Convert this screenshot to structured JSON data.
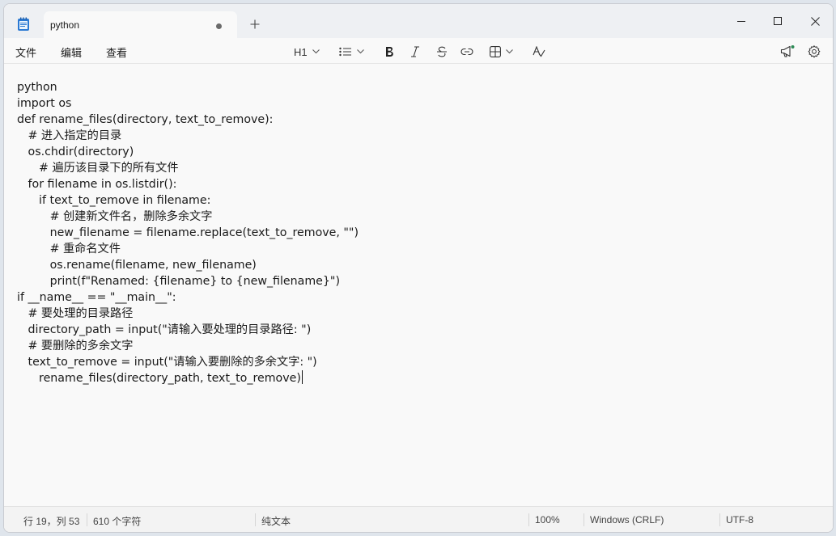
{
  "tab": {
    "title": "python"
  },
  "menu": {
    "file": "文件",
    "edit": "编辑",
    "view": "查看"
  },
  "toolbar": {
    "heading_label": "H1"
  },
  "editor": {
    "lines": [
      "python",
      "import os",
      "def rename_files(directory, text_to_remove):",
      "   # 进入指定的目录",
      "   os.chdir(directory)",
      "      # 遍历该目录下的所有文件",
      "   for filename in os.listdir():",
      "      if text_to_remove in filename:",
      "         # 创建新文件名，删除多余文字",
      "         new_filename = filename.replace(text_to_remove, \"\")",
      "         # 重命名文件",
      "         os.rename(filename, new_filename)",
      "         print(f\"Renamed: {filename} to {new_filename}\")",
      "if __name__ == \"__main__\":",
      "   # 要处理的目录路径",
      "   directory_path = input(\"请输入要处理的目录路径: \")",
      "   # 要删除的多余文字",
      "   text_to_remove = input(\"请输入要删除的多余文字: \")",
      "      rename_files(directory_path, text_to_remove)"
    ]
  },
  "status": {
    "position": "行 19，列 53",
    "char_count": "610 个字符",
    "format": "纯文本",
    "zoom": "100%",
    "line_ending": "Windows (CRLF)",
    "encoding": "UTF-8"
  },
  "colors": {
    "accent": "#2e8b57",
    "background": "#f9f9f9",
    "titlebar": "#eef0f3"
  }
}
